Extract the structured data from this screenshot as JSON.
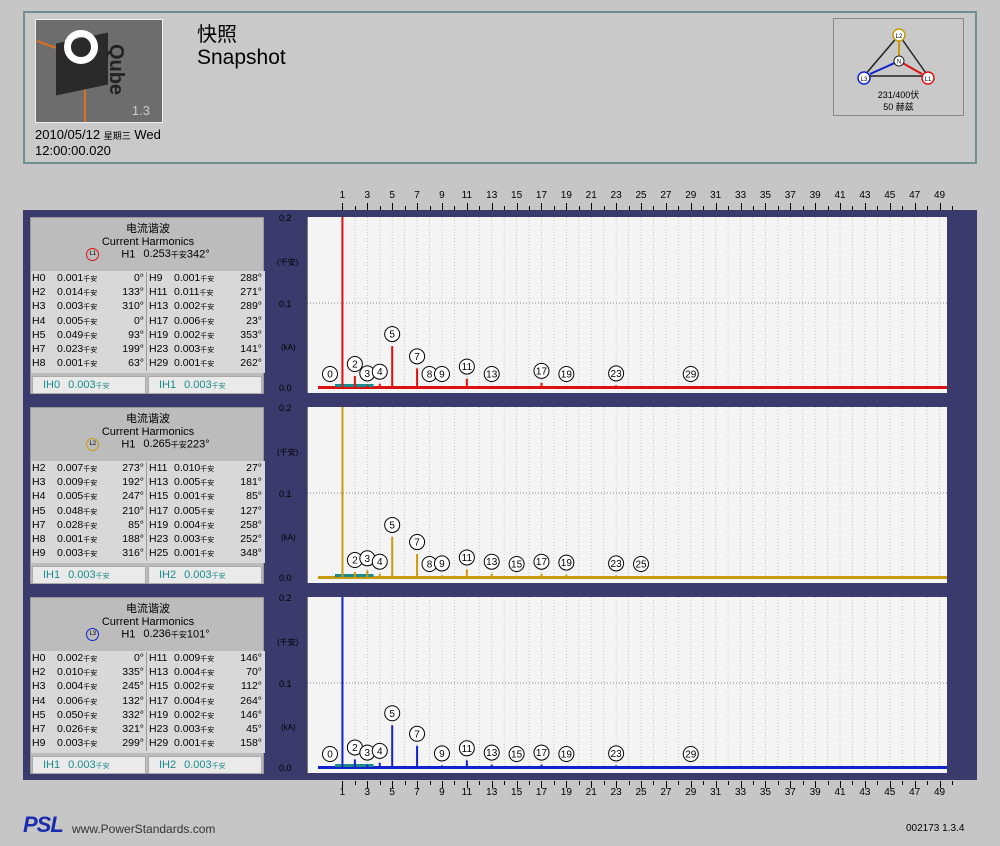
{
  "header": {
    "title_cn": "快照",
    "title_en": "Snapshot",
    "date_value": "2010/05/12",
    "day_cn": "星期三",
    "day_en": "Wed",
    "time": "12:00:00.020",
    "logo": {
      "brand": "Qube",
      "version": "1.3"
    },
    "wiring": {
      "voltage": "231/400伏",
      "frequency": "50 赫兹",
      "nodes": [
        "L2",
        "N",
        "L3",
        "L1"
      ]
    }
  },
  "colors": {
    "L1": "#dd1111",
    "L2": "#c89a10",
    "L3": "#1122cc",
    "ih": "#1a8a8a"
  },
  "x_ticks": [
    "1",
    "3",
    "5",
    "7",
    "9",
    "11",
    "13",
    "15",
    "17",
    "19",
    "21",
    "23",
    "25",
    "27",
    "29",
    "31",
    "33",
    "35",
    "37",
    "39",
    "41",
    "43",
    "45",
    "47",
    "49"
  ],
  "panels": [
    {
      "title_cn": "电流谐波",
      "title_en": "Current Harmonics",
      "phase": "L1",
      "h1_label": "H1",
      "h1_value": "0.253",
      "h1_unit": "千安",
      "h1_phase": "342°",
      "left_rows": [
        {
          "h": "H0",
          "v": "0.001",
          "u": "千安",
          "p": "0°"
        },
        {
          "h": "H2",
          "v": "0.014",
          "u": "千安",
          "p": "133°"
        },
        {
          "h": "H3",
          "v": "0.003",
          "u": "千安",
          "p": "310°"
        },
        {
          "h": "H4",
          "v": "0.005",
          "u": "千安",
          "p": "0°"
        },
        {
          "h": "H5",
          "v": "0.049",
          "u": "千安",
          "p": "93°"
        },
        {
          "h": "H7",
          "v": "0.023",
          "u": "千安",
          "p": "199°"
        },
        {
          "h": "H8",
          "v": "0.001",
          "u": "千安",
          "p": "63°"
        }
      ],
      "right_rows": [
        {
          "h": "H9",
          "v": "0.001",
          "u": "千安",
          "p": "288°"
        },
        {
          "h": "H11",
          "v": "0.011",
          "u": "千安",
          "p": "271°"
        },
        {
          "h": "H13",
          "v": "0.002",
          "u": "千安",
          "p": "289°"
        },
        {
          "h": "H17",
          "v": "0.006",
          "u": "千安",
          "p": "23°"
        },
        {
          "h": "H19",
          "v": "0.002",
          "u": "千安",
          "p": "353°"
        },
        {
          "h": "H23",
          "v": "0.003",
          "u": "千安",
          "p": "141°"
        },
        {
          "h": "H29",
          "v": "0.001",
          "u": "千安",
          "p": "262°"
        }
      ],
      "ih_left": {
        "label": "IH0",
        "v": "0.003",
        "u": "千安"
      },
      "ih_right": {
        "label": "IH1",
        "v": "0.003",
        "u": "千安"
      }
    },
    {
      "title_cn": "电流谐波",
      "title_en": "Current Harmonics",
      "phase": "L2",
      "h1_label": "H1",
      "h1_value": "0.265",
      "h1_unit": "千安",
      "h1_phase": "223°",
      "left_rows": [
        {
          "h": "H2",
          "v": "0.007",
          "u": "千安",
          "p": "273°"
        },
        {
          "h": "H3",
          "v": "0.009",
          "u": "千安",
          "p": "192°"
        },
        {
          "h": "H4",
          "v": "0.005",
          "u": "千安",
          "p": "247°"
        },
        {
          "h": "H5",
          "v": "0.048",
          "u": "千安",
          "p": "210°"
        },
        {
          "h": "H7",
          "v": "0.028",
          "u": "千安",
          "p": "85°"
        },
        {
          "h": "H8",
          "v": "0.001",
          "u": "千安",
          "p": "188°"
        },
        {
          "h": "H9",
          "v": "0.003",
          "u": "千安",
          "p": "316°"
        }
      ],
      "right_rows": [
        {
          "h": "H11",
          "v": "0.010",
          "u": "千安",
          "p": "27°"
        },
        {
          "h": "H13",
          "v": "0.005",
          "u": "千安",
          "p": "181°"
        },
        {
          "h": "H15",
          "v": "0.001",
          "u": "千安",
          "p": "85°"
        },
        {
          "h": "H17",
          "v": "0.005",
          "u": "千安",
          "p": "127°"
        },
        {
          "h": "H19",
          "v": "0.004",
          "u": "千安",
          "p": "258°"
        },
        {
          "h": "H23",
          "v": "0.003",
          "u": "千安",
          "p": "252°"
        },
        {
          "h": "H25",
          "v": "0.001",
          "u": "千安",
          "p": "348°"
        }
      ],
      "ih_left": {
        "label": "IH1",
        "v": "0.003",
        "u": "千安"
      },
      "ih_right": {
        "label": "IH2",
        "v": "0.003",
        "u": "千安"
      }
    },
    {
      "title_cn": "电流谐波",
      "title_en": "Current Harmonics",
      "phase": "L3",
      "h1_label": "H1",
      "h1_value": "0.236",
      "h1_unit": "千安",
      "h1_phase": "101°",
      "left_rows": [
        {
          "h": "H0",
          "v": "0.002",
          "u": "千安",
          "p": "0°"
        },
        {
          "h": "H2",
          "v": "0.010",
          "u": "千安",
          "p": "335°"
        },
        {
          "h": "H3",
          "v": "0.004",
          "u": "千安",
          "p": "245°"
        },
        {
          "h": "H4",
          "v": "0.006",
          "u": "千安",
          "p": "132°"
        },
        {
          "h": "H5",
          "v": "0.050",
          "u": "千安",
          "p": "332°"
        },
        {
          "h": "H7",
          "v": "0.026",
          "u": "千安",
          "p": "321°"
        },
        {
          "h": "H9",
          "v": "0.003",
          "u": "千安",
          "p": "299°"
        }
      ],
      "right_rows": [
        {
          "h": "H11",
          "v": "0.009",
          "u": "千安",
          "p": "146°"
        },
        {
          "h": "H13",
          "v": "0.004",
          "u": "千安",
          "p": "70°"
        },
        {
          "h": "H15",
          "v": "0.002",
          "u": "千安",
          "p": "112°"
        },
        {
          "h": "H17",
          "v": "0.004",
          "u": "千安",
          "p": "264°"
        },
        {
          "h": "H19",
          "v": "0.002",
          "u": "千安",
          "p": "146°"
        },
        {
          "h": "H23",
          "v": "0.003",
          "u": "千安",
          "p": "45°"
        },
        {
          "h": "H29",
          "v": "0.001",
          "u": "千安",
          "p": "158°"
        }
      ],
      "ih_left": {
        "label": "IH1",
        "v": "0.003",
        "u": "千安"
      },
      "ih_right": {
        "label": "IH2",
        "v": "0.003",
        "u": "千安"
      }
    }
  ],
  "chart_data": [
    {
      "type": "bar",
      "series": [
        {
          "name": "L1",
          "x": [
            0,
            1,
            2,
            3,
            4,
            5,
            7,
            8,
            9,
            11,
            13,
            17,
            19,
            23,
            29
          ],
          "values": [
            0.001,
            0.253,
            0.014,
            0.003,
            0.005,
            0.049,
            0.023,
            0.001,
            0.001,
            0.011,
            0.002,
            0.006,
            0.002,
            0.003,
            0.001
          ]
        }
      ],
      "y_ticks": [
        "0.2",
        "0.1",
        "0.0"
      ],
      "ylabel_cn": "(千安)",
      "ylabel_en": "(kA)",
      "ylim": [
        0,
        0.2
      ],
      "xlim": [
        0,
        50
      ],
      "grid": true
    },
    {
      "type": "bar",
      "series": [
        {
          "name": "L2",
          "x": [
            1,
            2,
            3,
            4,
            5,
            7,
            8,
            9,
            11,
            13,
            15,
            17,
            19,
            23,
            25
          ],
          "values": [
            0.265,
            0.007,
            0.009,
            0.005,
            0.048,
            0.028,
            0.001,
            0.003,
            0.01,
            0.005,
            0.001,
            0.005,
            0.004,
            0.003,
            0.001
          ]
        }
      ],
      "y_ticks": [
        "0.2",
        "0.1",
        "0.0"
      ],
      "ylabel_cn": "(千安)",
      "ylabel_en": "(kA)",
      "ylim": [
        0,
        0.2
      ],
      "xlim": [
        0,
        50
      ],
      "grid": true
    },
    {
      "type": "bar",
      "series": [
        {
          "name": "L3",
          "x": [
            0,
            1,
            2,
            3,
            4,
            5,
            7,
            9,
            11,
            13,
            15,
            17,
            19,
            23,
            29
          ],
          "values": [
            0.002,
            0.236,
            0.01,
            0.004,
            0.006,
            0.05,
            0.026,
            0.003,
            0.009,
            0.004,
            0.002,
            0.004,
            0.002,
            0.003,
            0.001
          ]
        }
      ],
      "y_ticks": [
        "0.2",
        "0.1",
        "0.0"
      ],
      "ylabel_cn": "(千安)",
      "ylabel_en": "(kA)",
      "ylim": [
        0,
        0.2
      ],
      "xlim": [
        0,
        50
      ],
      "grid": true
    }
  ],
  "footer": {
    "logo": "PSL",
    "url": "www.PowerStandards.com",
    "version": "002173  1.3.4"
  }
}
